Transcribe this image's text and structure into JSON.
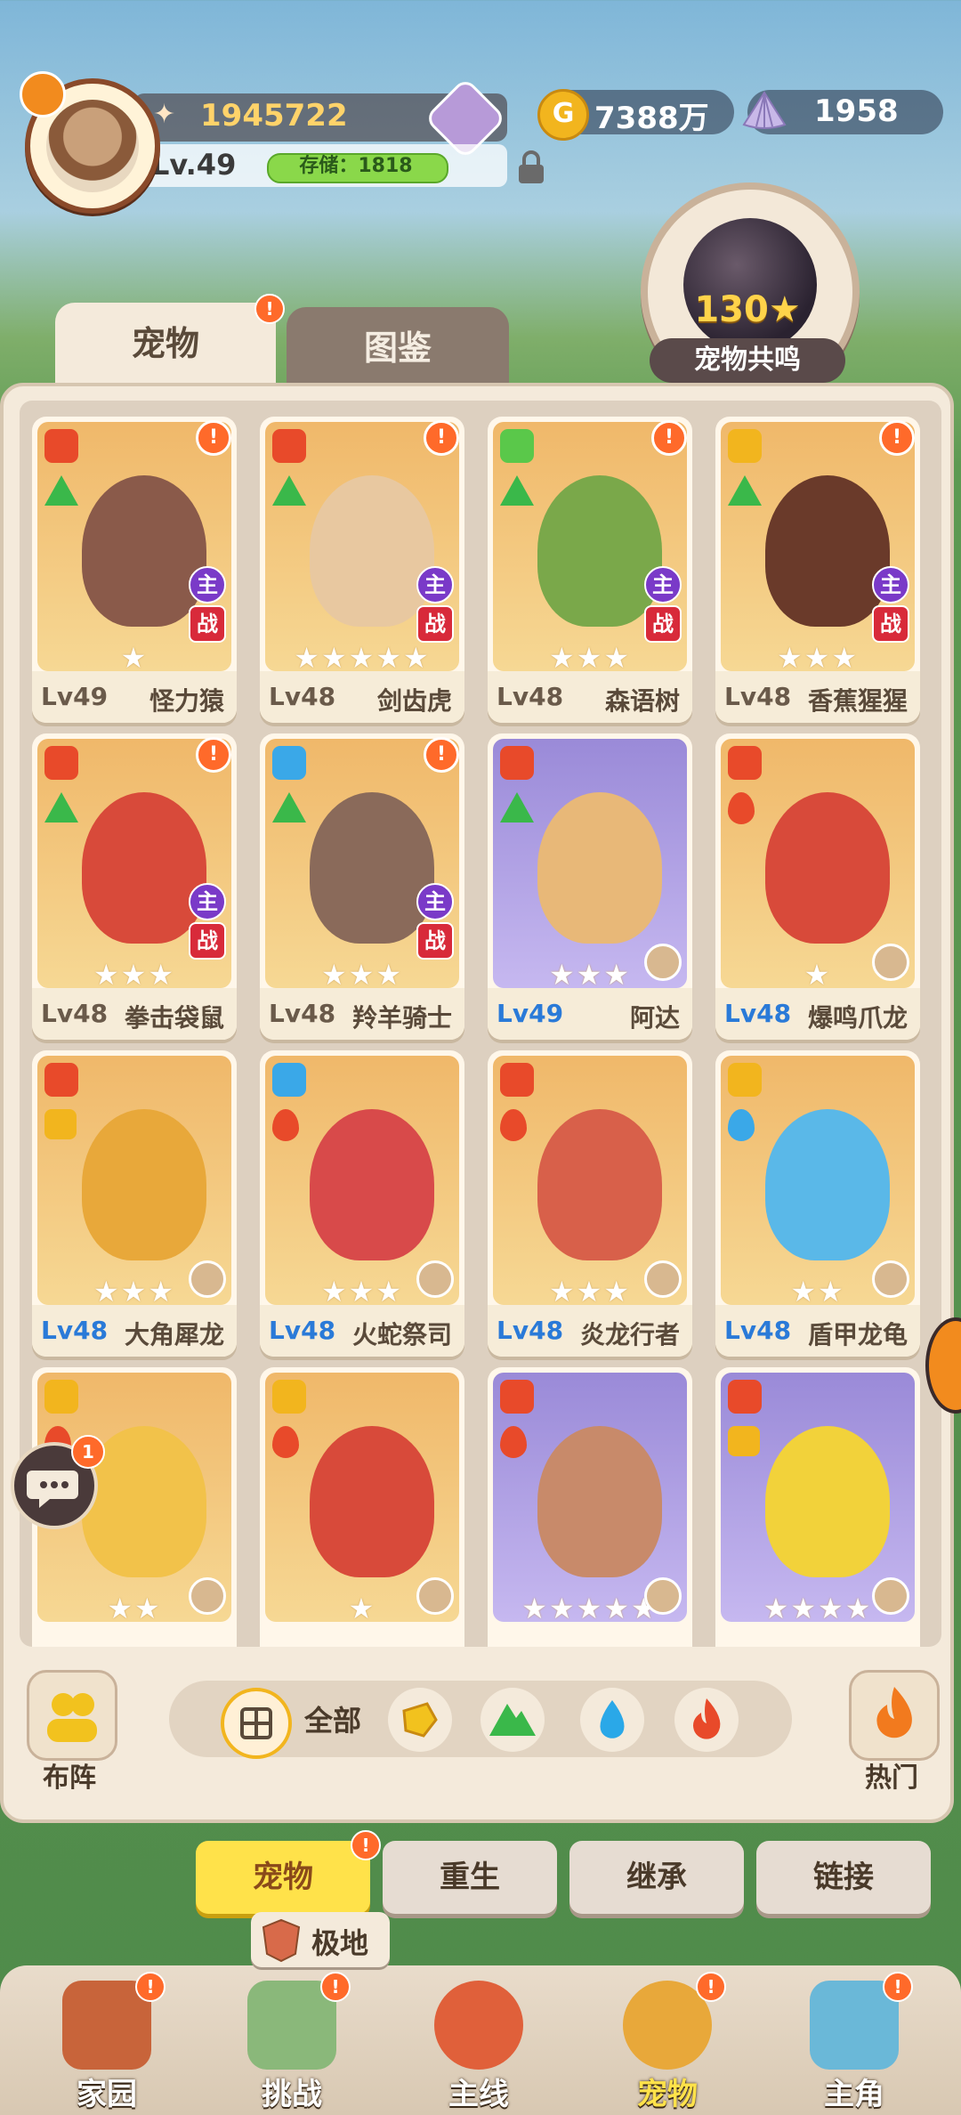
{
  "player": {
    "power": "1945722",
    "level": "Lv.49",
    "storage": "存储：1818"
  },
  "currency": {
    "coins": "7388万",
    "coin_symbol": "G",
    "shells": "1958"
  },
  "resonance": {
    "value": "130",
    "label": "宠物共鸣"
  },
  "tabs": {
    "pets": "宠物",
    "codex": "图鉴"
  },
  "badges": {
    "alert": "!",
    "main": "主",
    "battle": "战"
  },
  "cards": [
    {
      "level": "Lv49",
      "name": "怪力猿",
      "stars": "★",
      "variant": "orange"
    },
    {
      "level": "Lv48",
      "name": "剑齿虎",
      "stars": "★★★★★",
      "variant": "orange"
    },
    {
      "level": "Lv48",
      "name": "森语树",
      "stars": "★★★",
      "variant": "orange"
    },
    {
      "level": "Lv48",
      "name": "香蕉猩猩",
      "stars": "★★★",
      "variant": "orange"
    },
    {
      "level": "Lv48",
      "name": "拳击袋鼠",
      "stars": "★★★",
      "variant": "orange"
    },
    {
      "level": "Lv48",
      "name": "羚羊骑士",
      "stars": "★★★",
      "variant": "orange"
    },
    {
      "level": "Lv49",
      "name": "阿达",
      "stars": "★★★",
      "variant": "purple"
    },
    {
      "level": "Lv48",
      "name": "爆鸣爪龙",
      "stars": "★",
      "variant": "orange"
    },
    {
      "level": "Lv48",
      "name": "大角犀龙",
      "stars": "★★★",
      "variant": "orange"
    },
    {
      "level": "Lv48",
      "name": "火蛇祭司",
      "stars": "★★★",
      "variant": "orange"
    },
    {
      "level": "Lv48",
      "name": "炎龙行者",
      "stars": "★★★",
      "variant": "orange"
    },
    {
      "level": "Lv48",
      "name": "盾甲龙龟",
      "stars": "★★",
      "variant": "orange"
    },
    {
      "stars": "★★",
      "variant": "orange"
    },
    {
      "stars": "★",
      "variant": "orange"
    },
    {
      "stars": "★★★★★",
      "variant": "purple"
    },
    {
      "stars": "★★★★",
      "variant": "purple"
    }
  ],
  "filters": {
    "formation": "布阵",
    "all": "全部",
    "hot": "热门"
  },
  "subtabs": [
    "宠物",
    "重生",
    "继承",
    "链接"
  ],
  "tooltip": "极地",
  "chat_count": "1",
  "nav": [
    "家园",
    "挑战",
    "主线",
    "宠物",
    "主角"
  ]
}
